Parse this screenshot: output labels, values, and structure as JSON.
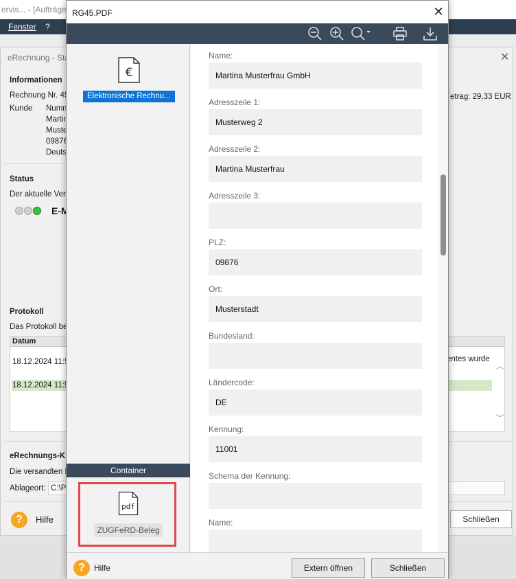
{
  "background_app": {
    "title_fragment": "ervis... - [Aufträge",
    "menu": [
      "Fenster",
      "?"
    ],
    "window_title": "eRechnung - Sta",
    "section_info": "Informationen",
    "rechnung_label": "Rechnung Nr. 45",
    "kunde_label": "Kunde",
    "kunde_lines": [
      "Numm",
      "Martin",
      "Muste",
      "09876",
      "Deuts"
    ],
    "betrag": "etrag: 29,33 EUR",
    "section_status": "Status",
    "status_text": "Der aktuelle Vera",
    "status_state": "E-M",
    "section_protokoll": "Protokoll",
    "protokoll_text": "Das Protokoll be",
    "table_header_datum": "Datum",
    "table_rows": [
      "18.12.2024 11:5",
      "18.12.2024 11:5"
    ],
    "table_right_text": "entes wurde",
    "section_erechnungs": "eRechnungs-K",
    "erechnungs_text": "Die versandten D",
    "ablageort_label": "Ablageort:",
    "ablageort_value": "C:\\P",
    "help_label": "Hilfe",
    "close_label": "Schließen"
  },
  "viewer": {
    "title": "RG45.PDF",
    "toolbar_icons": [
      "zoom-out-icon",
      "zoom-in-icon",
      "zoom-menu-icon",
      "print-icon",
      "download-icon"
    ],
    "left": {
      "document_label": "Elektronische Rechnu...",
      "container_header": "Container",
      "container_icon_text": "pdf",
      "container_item_label": "ZUGFeRD-Beleg"
    },
    "fields": [
      {
        "label": "Name:",
        "value": "Martina Musterfrau GmbH"
      },
      {
        "label": "Adresszeile 1:",
        "value": "Musterweg 2"
      },
      {
        "label": "Adresszeile 2:",
        "value": "Martina Musterfrau"
      },
      {
        "label": "Adresszeile 3:",
        "value": ""
      },
      {
        "label": "PLZ:",
        "value": "09876"
      },
      {
        "label": "Ort:",
        "value": "Musterstadt"
      },
      {
        "label": "Bundesland:",
        "value": ""
      },
      {
        "label": "Ländercode:",
        "value": "DE"
      },
      {
        "label": "Kennung:",
        "value": "11001"
      },
      {
        "label": "Schema der Kennung:",
        "value": ""
      },
      {
        "label": "Name:",
        "value": ""
      }
    ],
    "footer": {
      "help_label": "Hilfe",
      "open_external_label": "Extern öffnen",
      "close_label": "Schließen"
    }
  },
  "colors": {
    "toolbar": "#3a4a5c",
    "selection": "#0b74d6",
    "highlight_border": "#e04848",
    "help_icon": "#f5a623"
  }
}
